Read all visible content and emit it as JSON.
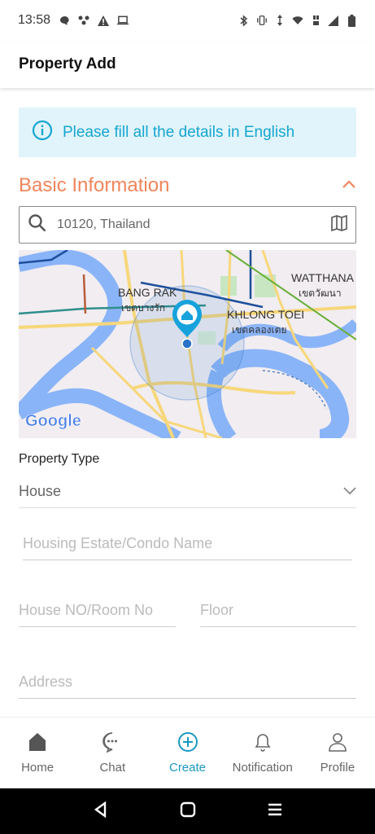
{
  "status_bar": {
    "time": "13:58"
  },
  "header": {
    "title": "Property Add"
  },
  "banner": {
    "text": "Please fill all the details in English"
  },
  "section": {
    "title": "Basic Information"
  },
  "search": {
    "value": "10120, Thailand"
  },
  "map": {
    "labels": {
      "bang_rak_en": "BANG RAK",
      "bang_rak_th": "เขตบางรัก",
      "khlong_toei_en": "KHLONG TOEI",
      "khlong_toei_th": "เขตคลองเตย",
      "watthana_en": "WATTHANA",
      "watthana_th": "เขตวัฒนา",
      "logo": "Google"
    }
  },
  "form": {
    "property_type_label": "Property Type",
    "property_type_value": "House",
    "estate_placeholder": "Housing Estate/Condo Name",
    "house_no_placeholder": "House NO/Room No",
    "floor_placeholder": "Floor",
    "address_placeholder": "Address"
  },
  "bottom_nav": {
    "items": [
      {
        "label": "Home",
        "icon": "home-icon"
      },
      {
        "label": "Chat",
        "icon": "chat-icon"
      },
      {
        "label": "Create",
        "icon": "create-icon"
      },
      {
        "label": "Notification",
        "icon": "bell-icon"
      },
      {
        "label": "Profile",
        "icon": "profile-icon"
      }
    ],
    "active_index": 2
  },
  "colors": {
    "accent": "#1a98c2",
    "section": "#f0855a",
    "banner_bg": "#e1f4fb",
    "banner_text": "#15a6d0"
  }
}
